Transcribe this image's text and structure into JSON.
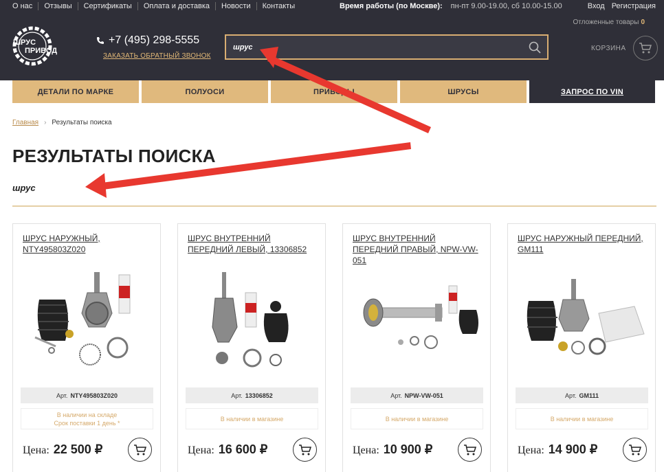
{
  "topnav": {
    "links": [
      "О нас",
      "Отзывы",
      "Сертификаты",
      "Оплата и доставка",
      "Новости",
      "Контакты"
    ],
    "worktime_label": "Время работы (по Москве):",
    "worktime_value": "пн-пт 9.00-19.00, сб 10.00-15.00",
    "login": "Вход",
    "register": "Регистрация"
  },
  "deferred": {
    "label": "Отложенные товары",
    "count": "0"
  },
  "logo": {
    "line1": "ШРУС",
    "line2": "ПРИВОД",
    "ring": "ЗАПЧАСТИ ДОСТАВКА МОСКВА"
  },
  "phone": {
    "number": "+7 (495) 298-5555",
    "callback": "ЗАКАЗАТЬ ОБРАТНЫЙ ЗВОНОК"
  },
  "search": {
    "value": "шрус"
  },
  "cart": {
    "label": "КОРЗИНА"
  },
  "categories": [
    "ДЕТАЛИ ПО МАРКЕ",
    "ПОЛУОСИ",
    "ПРИВОДЫ",
    "ШРУСЫ",
    "ЗАПРОС ПО VIN"
  ],
  "breadcrumb": {
    "home": "Главная",
    "current": "Результаты поиска"
  },
  "page": {
    "title": "РЕЗУЛЬТАТЫ ПОИСКА",
    "query": "шрус"
  },
  "products": [
    {
      "name": "ШРУС НАРУЖНЫЙ, NTY495803Z020",
      "art_label": "Арт.",
      "art": "NTY495803Z020",
      "stock_line1": "В наличии на складе",
      "stock_line2": "Срок поставки 1 день *",
      "price_label": "Цена:",
      "price": "22 500 ₽"
    },
    {
      "name": "ШРУС ВНУТРЕННИЙ ПЕРЕДНИЙ ЛЕВЫЙ, 13306852",
      "art_label": "Арт.",
      "art": "13306852",
      "stock_line1": "В наличии в магазине",
      "stock_line2": "",
      "price_label": "Цена:",
      "price": "16 600 ₽"
    },
    {
      "name": "ШРУС ВНУТРЕННИЙ ПЕРЕДНИЙ ПРАВЫЙ, NPW-VW-051",
      "art_label": "Арт.",
      "art": "NPW-VW-051",
      "stock_line1": "В наличии в магазине",
      "stock_line2": "",
      "price_label": "Цена:",
      "price": "10 900 ₽"
    },
    {
      "name": "ШРУС НАРУЖНЫЙ ПЕРЕДНИЙ, GM111",
      "art_label": "Арт.",
      "art": "GM111",
      "stock_line1": "В наличии в магазине",
      "stock_line2": "",
      "price_label": "Цена:",
      "price": "14 900 ₽"
    }
  ],
  "colors": {
    "dark": "#2f2f38",
    "accent": "#e0b97d",
    "arrow": "#e8382f"
  }
}
